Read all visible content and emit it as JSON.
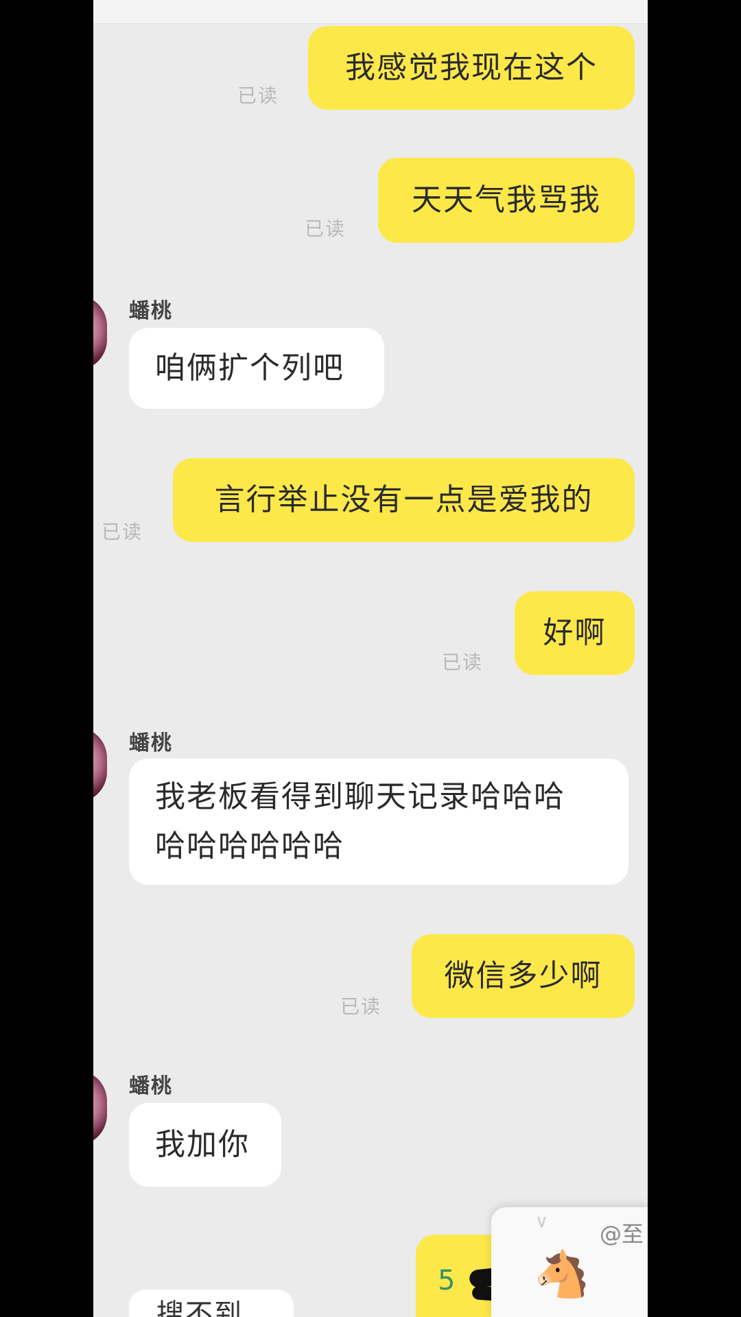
{
  "status": {
    "read_label": "已读"
  },
  "contact": {
    "name": "蟠桃"
  },
  "messages": [
    {
      "side": "self",
      "text": "我感觉我现在这个"
    },
    {
      "side": "self",
      "text": "天天气我骂我"
    },
    {
      "side": "other",
      "text": "咱俩扩个列吧"
    },
    {
      "side": "self",
      "text": "言行举止没有一点是爱我的"
    },
    {
      "side": "self",
      "text": "好啊"
    },
    {
      "side": "other",
      "lines": [
        "我老板看得到聊天记录哈哈哈",
        "哈哈哈哈哈哈"
      ]
    },
    {
      "side": "self",
      "text": "微信多少啊"
    },
    {
      "side": "other",
      "text": "我加你"
    }
  ],
  "partial": {
    "bottom_other_text": "搜不到",
    "bottom_self_text": "5",
    "card_label": "@至",
    "card_chevron": "∨",
    "horse_emoji": "🐴"
  },
  "colors": {
    "self_bubble": "#fde84a",
    "other_bubble": "#ffffff",
    "background": "#ebebeb",
    "read_text": "#b9b9b9"
  }
}
